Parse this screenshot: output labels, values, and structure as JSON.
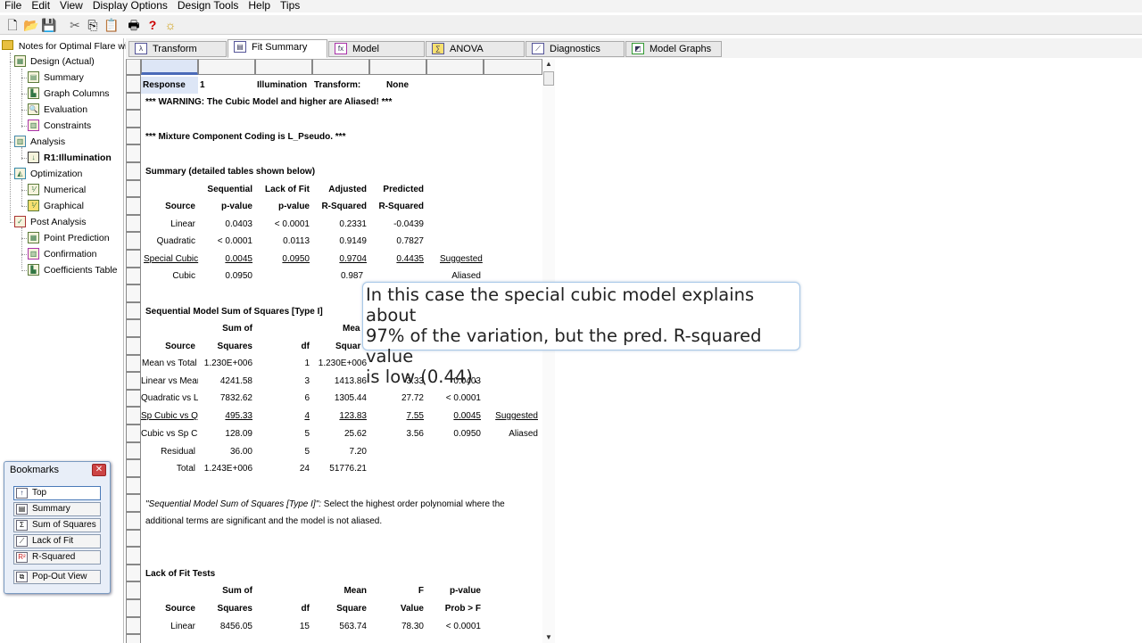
{
  "menu": [
    "File",
    "Edit",
    "View",
    "Display Options",
    "Design Tools",
    "Help",
    "Tips"
  ],
  "toolbar_icons": [
    "new-file-icon",
    "open-folder-icon",
    "save-icon",
    "cut-icon",
    "copy-icon",
    "paste-icon",
    "print-icon",
    "help-icon",
    "tip-bulb-icon"
  ],
  "tree": {
    "root": "Notes for Optimal Flare wit",
    "design": "Design (Actual)",
    "summary": "Summary",
    "graph_columns": "Graph Columns",
    "evaluation": "Evaluation",
    "constraints": "Constraints",
    "analysis": "Analysis",
    "r1": "R1:Illumination",
    "optimization": "Optimization",
    "numerical": "Numerical",
    "graphical": "Graphical",
    "post_analysis": "Post Analysis",
    "point_prediction": "Point Prediction",
    "confirmation": "Confirmation",
    "coefficients_table": "Coefficients Table"
  },
  "tabs": [
    "Transform",
    "Fit Summary",
    "Model",
    "ANOVA",
    "Diagnostics",
    "Model Graphs"
  ],
  "report": {
    "response_label": "Response",
    "response_num": "1",
    "response_name": "Illumination",
    "transform_label": "Transform:",
    "transform_value": "None",
    "warning": "*** WARNING:  The Cubic Model and higher are Aliased! ***",
    "coding": "*** Mixture Component Coding is L_Pseudo. ***",
    "summary_title": "Summary (detailed tables shown below)",
    "summary_head1": [
      "Sequential",
      "Lack of Fit",
      "Adjusted",
      "Predicted"
    ],
    "summary_head2": [
      "Source",
      "p-value",
      "p-value",
      "R-Squared",
      "R-Squared"
    ],
    "summary_rows": [
      [
        "Linear",
        "0.0403",
        "< 0.0001",
        "0.2331",
        "-0.0439",
        ""
      ],
      [
        "Quadratic",
        "< 0.0001",
        "0.0113",
        "0.9149",
        "0.7827",
        ""
      ],
      [
        "Special Cubic",
        "0.0045",
        "0.0950",
        "0.9704",
        "0.4435",
        "Suggested"
      ],
      [
        "Cubic",
        "0.0950",
        "",
        "0.987",
        "",
        "Aliased"
      ]
    ],
    "seq_title": "Sequential Model Sum of Squares [Type I]",
    "seq_head1": [
      "Sum of",
      "Mea"
    ],
    "seq_head2": [
      "Source",
      "Squares",
      "df",
      "Squar"
    ],
    "seq_rows": [
      [
        "Mean vs Total",
        "1.230E+006",
        "1",
        "1.230E+006",
        "",
        "",
        ""
      ],
      [
        "Linear vs Mear",
        "4241.58",
        "3",
        "1413.86",
        "3.33",
        "0.0403",
        ""
      ],
      [
        "Quadratic vs L",
        "7832.62",
        "6",
        "1305.44",
        "27.72",
        "< 0.0001",
        ""
      ],
      [
        "Sp Cubic vs Qu",
        "495.33",
        "4",
        "123.83",
        "7.55",
        "0.0045",
        "Suggested"
      ],
      [
        "Cubic vs Sp Cu",
        "128.09",
        "5",
        "25.62",
        "3.56",
        "0.0950",
        "Aliased"
      ],
      [
        "Residual",
        "36.00",
        "5",
        "7.20",
        "",
        "",
        ""
      ],
      [
        "Total",
        "1.243E+006",
        "24",
        "51776.21",
        "",
        "",
        ""
      ]
    ],
    "note_italic": "\"Sequential Model Sum of Squares [Type I]\":",
    "note_rest": "  Select the highest order polynomial where the",
    "note_line2": "additional terms are significant and the model is not aliased.",
    "lof_title": "Lack of Fit Tests",
    "lof_head1": [
      "Sum of",
      "Mean",
      "F",
      "p-value"
    ],
    "lof_head2": [
      "Source",
      "Squares",
      "df",
      "Square",
      "Value",
      "Prob > F"
    ],
    "lof_rows": [
      [
        "Linear",
        "8456.05",
        "15",
        "563.74",
        "78.30",
        "< 0.0001"
      ]
    ]
  },
  "tooltip": {
    "line1": "In this case the special cubic model explains about",
    "line2": "97% of the variation, but the pred. R-squared value",
    "line3": "is low (0.44)."
  },
  "bookmarks": {
    "title": "Bookmarks",
    "items": [
      "Top",
      "Summary",
      "Sum of Squares",
      "Lack of Fit",
      "R-Squared"
    ],
    "popout": "Pop-Out View"
  }
}
